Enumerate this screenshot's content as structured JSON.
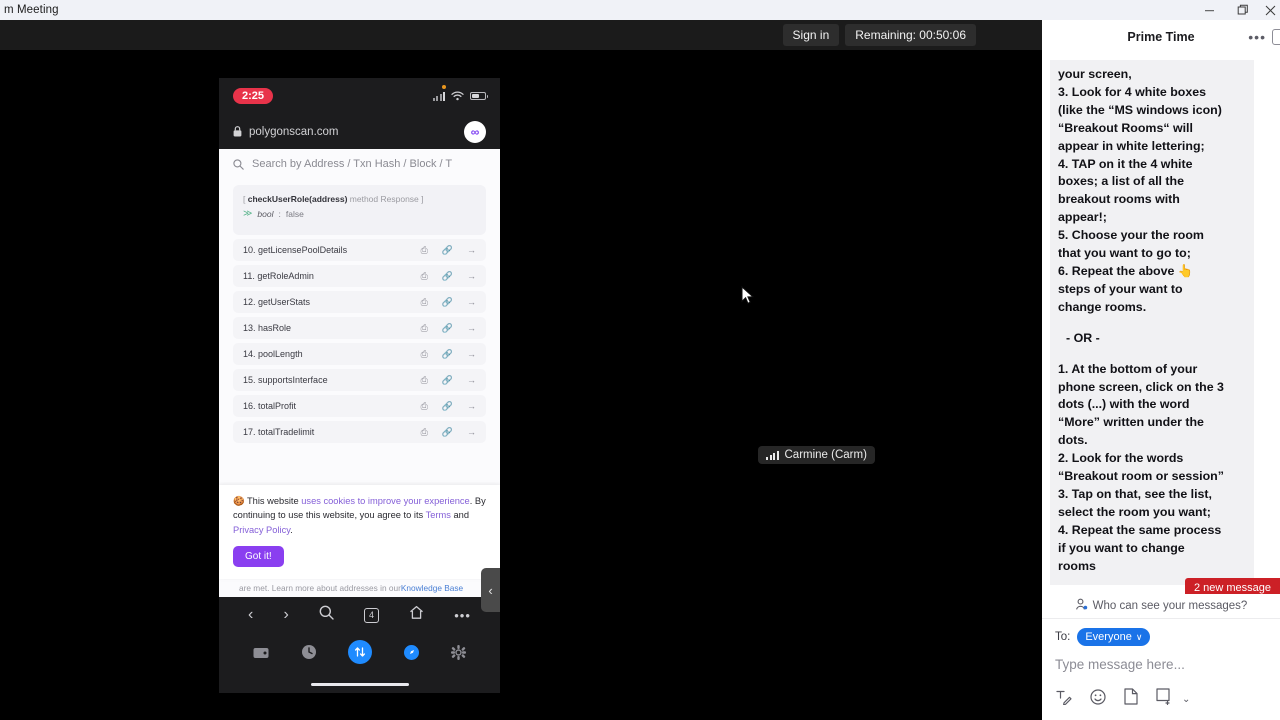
{
  "window": {
    "title": "m Meeting",
    "controls": [
      {
        "name": "minimize",
        "glyph": "minimize-icon"
      },
      {
        "name": "restore",
        "glyph": "restore-icon"
      },
      {
        "name": "close",
        "glyph": "close-icon"
      }
    ]
  },
  "stage": {
    "sign_in_label": "Sign in",
    "remaining_label": "Remaining: 00:50:06",
    "participant_name": "Carmine (Carm)",
    "collapse_handle_glyph": "‹"
  },
  "phone": {
    "status": {
      "time": "2:25",
      "signal": "signal-bars-icon",
      "wifi": "wifi-icon",
      "battery": "battery-icon"
    },
    "browser": {
      "lock": "lock-icon",
      "url": "polygonscan.com",
      "badge": "∞",
      "tab_count": "4"
    },
    "search_placeholder": "Search by Address / Txn Hash / Block / T",
    "response": {
      "method": "checkUserRole(address)",
      "prefix": "[ ",
      "suffix": " method Response ]",
      "chevron": "≫",
      "type": "bool",
      "colon": ":",
      "value": "false"
    },
    "functions": [
      {
        "index": "10.",
        "name": "getLicensePoolDetails"
      },
      {
        "index": "11.",
        "name": "getRoleAdmin"
      },
      {
        "index": "12.",
        "name": "getUserStats"
      },
      {
        "index": "13.",
        "name": "hasRole"
      },
      {
        "index": "14.",
        "name": "poolLength"
      },
      {
        "index": "15.",
        "name": "supportsInterface"
      },
      {
        "index": "16.",
        "name": "totalProfit"
      },
      {
        "index": "17.",
        "name": "totalTradelimit"
      }
    ],
    "cookie": {
      "icon": "cookie-icon",
      "t1": "This website ",
      "link1": "uses cookies to improve your experience",
      "t2": ". By continuing to use this website, you agree to its ",
      "link2": "Terms",
      "t3": " and ",
      "link3": "Privacy Policy",
      "t4": ".",
      "button": "Got it!"
    },
    "kb_strip": {
      "text": "are met. Learn more about addresses in our ",
      "link": "Knowledge Base"
    },
    "nav": {
      "back": "‹",
      "forward": "›",
      "search": "search-icon",
      "tabs": "4",
      "home": "home-icon",
      "more": "•••"
    }
  },
  "chat": {
    "title": "Prime Time",
    "more_glyph": "•••",
    "message_lines": [
      "your screen,",
      "3.  Look for 4 white boxes",
      "(like the “MS windows icon)",
      "“Breakout Rooms“ will",
      "appear in white lettering;",
      "4. TAP on it the 4 white",
      "boxes; a list of all the",
      "breakout rooms with",
      "appear!;",
      "5. Choose your the room",
      "that you want to go to;",
      "6. Repeat the above 👆",
      "steps of your want to",
      "change rooms."
    ],
    "or_divider": "- OR -",
    "message_lines_2": [
      "1. At the bottom of your",
      "phone screen, click on the 3",
      "dots (...) with the word",
      "“More” written under the",
      "dots.",
      "2. Look for the words",
      "“Breakout room or session”",
      "3. Tap on that, see the list,",
      "select the room you want;",
      "4. Repeat the same process",
      "if you want to change",
      "rooms"
    ],
    "new_messages_badge": "2 new message",
    "who_can_see": "Who can see your messages?",
    "compose": {
      "to_label": "To:",
      "to_value": "Everyone",
      "to_chevron": "∨",
      "placeholder": "Type message here...",
      "icons": [
        {
          "name": "format-icon"
        },
        {
          "name": "emoji-icon"
        },
        {
          "name": "file-icon"
        },
        {
          "name": "sticker-icon"
        },
        {
          "name": "chevron-down-icon"
        }
      ]
    }
  }
}
